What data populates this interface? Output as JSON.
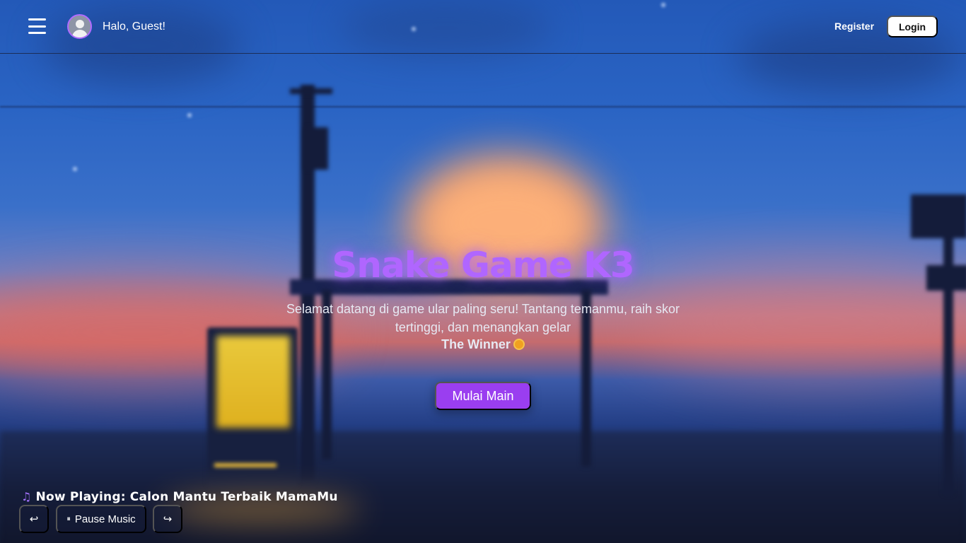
{
  "header": {
    "menu_icon": "hamburger-menu-icon",
    "avatar_icon": "user-avatar-icon",
    "greeting": "Halo, Guest!",
    "register_label": "Register",
    "login_label": "Login"
  },
  "hero": {
    "title": "Snake Game K3",
    "subtitle": "Selamat datang di game ular paling seru! Tantang temanmu, raih skor tertinggi, dan menangkan gelar",
    "winner_text": "The Winner",
    "winner_icon": "medal-icon",
    "start_button": "Mulai Main"
  },
  "music": {
    "note_icon": "music-note-icon",
    "now_playing": "Now Playing: Calon Mantu Terbaik MamaMu",
    "prev_glyph": "↩",
    "pause_label": "Pause Music",
    "pause_glyph": "⏸",
    "next_glyph": "↪"
  },
  "colors": {
    "accent_purple": "#9a3ef0",
    "title_purple": "#b066ff",
    "login_bg": "#ffffff"
  }
}
